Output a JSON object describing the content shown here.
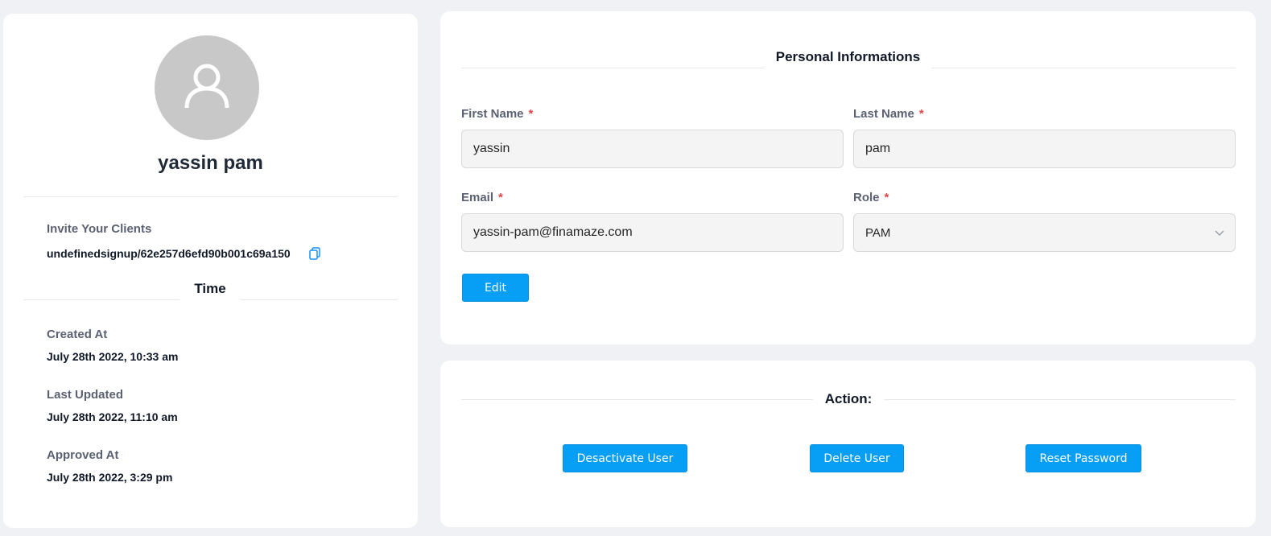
{
  "profile": {
    "name": "yassin pam",
    "invite_label": "Invite Your Clients",
    "invite_link": "undefinedsignup/62e257d6efd90b001c69a150",
    "time_title": "Time",
    "created_label": "Created At",
    "created_value": "July 28th 2022, 10:33 am",
    "updated_label": "Last Updated",
    "updated_value": "July 28th 2022, 11:10 am",
    "approved_label": "Approved At",
    "approved_value": "July 28th 2022, 3:29 pm"
  },
  "personal": {
    "title": "Personal Informations",
    "first_name_label": "First Name",
    "first_name_value": "yassin",
    "last_name_label": "Last Name",
    "last_name_value": "pam",
    "email_label": "Email",
    "email_value": "yassin-pam@finamaze.com",
    "role_label": "Role",
    "role_value": "PAM",
    "required_mark": "*",
    "edit_label": "Edit"
  },
  "actions": {
    "title": "Action:",
    "deactivate_label": "Desactivate User",
    "delete_label": "Delete User",
    "reset_label": "Reset Password"
  },
  "colors": {
    "primary": "#079ef5",
    "required": "#e0454b",
    "avatar_bg": "#c8c8c8",
    "page_bg": "#f0f1f4"
  },
  "icons": {
    "avatar": "user-icon",
    "copy": "copy-icon",
    "role_dropdown": "chevron-down-icon"
  }
}
